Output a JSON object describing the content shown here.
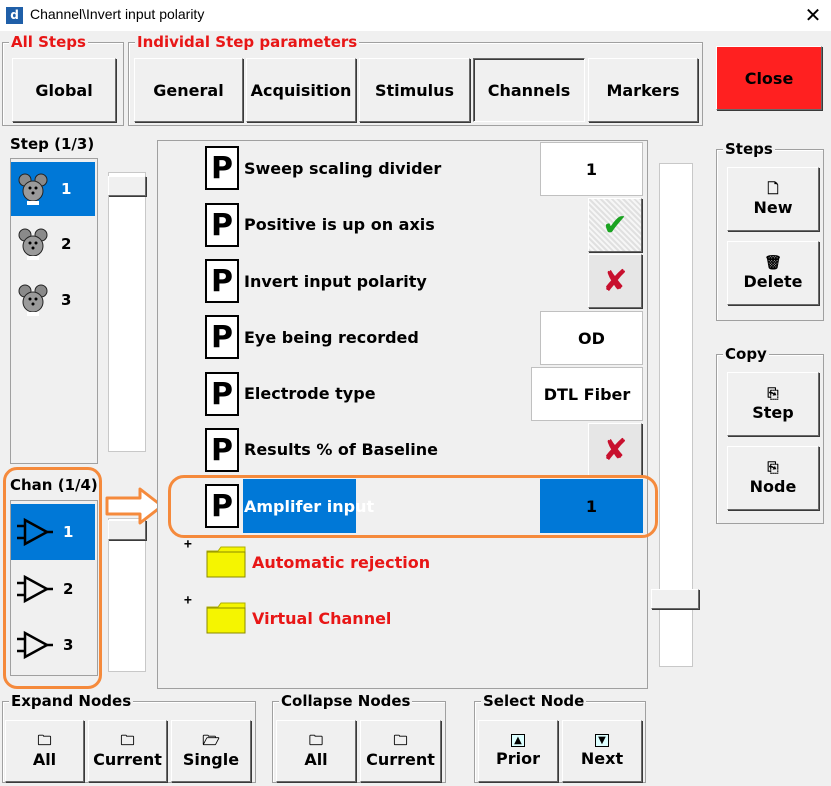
{
  "window": {
    "title": "Channel\\Invert input polarity",
    "app_icon": "d",
    "close_glyph": "✕"
  },
  "groups": {
    "all_steps": "All Steps",
    "individual": "Individal Step parameters",
    "steps": "Steps",
    "copy": "Copy",
    "expand_nodes": "Expand Nodes",
    "collapse_nodes": "Collapse Nodes",
    "select_node": "Select Node"
  },
  "buttons": {
    "global": "Global",
    "close": "Close",
    "new": "New",
    "delete": "Delete",
    "copy_step": "Step",
    "copy_node": "Node",
    "expand_all": "All",
    "expand_current": "Current",
    "expand_single": "Single",
    "collapse_all": "All",
    "collapse_current": "Current",
    "prior": "Prior",
    "next": "Next"
  },
  "tabs": [
    "General",
    "Acquisition",
    "Stimulus",
    "Channels",
    "Markers"
  ],
  "active_tab": "Channels",
  "step_list": {
    "label": "Step (1/3)",
    "items": [
      "1",
      "2",
      "3"
    ],
    "selected": "1"
  },
  "chan_list": {
    "label": "Chan (1/4)",
    "items": [
      "1",
      "2",
      "3"
    ],
    "selected": "1"
  },
  "param_icon_letter": "P",
  "params": [
    {
      "label": "Sweep scaling divider",
      "value": "1"
    },
    {
      "label": "Positive is up on axis",
      "check": "✔"
    },
    {
      "label": "Invert input polarity",
      "check": "✘"
    },
    {
      "label": "Eye being recorded",
      "value": "OD"
    },
    {
      "label": "Electrode type",
      "value": "DTL Fiber"
    },
    {
      "label": "Results % of Baseline",
      "check": "✘"
    },
    {
      "label": "Amplifer input",
      "value": "1"
    }
  ],
  "folders": [
    {
      "label": "Automatic rejection",
      "expander": "+"
    },
    {
      "label": "Virtual Channel",
      "expander": "+"
    }
  ],
  "colors": {
    "accent": "#0078d7",
    "close_button": "#ff2020",
    "highlight_outline": "#f58a3c",
    "label_red": "#e81616",
    "check_green": "#1aa321",
    "cross_red": "#c8102e",
    "folder_yellow": "#f5f500"
  }
}
